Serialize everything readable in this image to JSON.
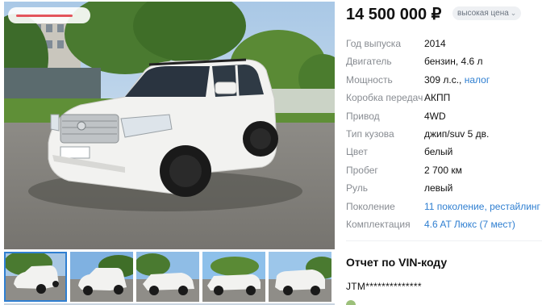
{
  "price": {
    "amount": "14 500 000 ₽",
    "badge_label": "высокая цена"
  },
  "specs": [
    {
      "label": "Год выпуска",
      "value": "2014"
    },
    {
      "label": "Двигатель",
      "value": "бензин, 4.6 л"
    },
    {
      "label": "Мощность",
      "value": "309 л.с.,",
      "link": "налог"
    },
    {
      "label": "Коробка передач",
      "value": "АКПП"
    },
    {
      "label": "Привод",
      "value": "4WD"
    },
    {
      "label": "Тип кузова",
      "value": "джип/suv 5 дв."
    },
    {
      "label": "Цвет",
      "value": "белый"
    },
    {
      "label": "Пробег",
      "value": "2 700 км"
    },
    {
      "label": "Руль",
      "value": "левый"
    },
    {
      "label": "Поколение",
      "link": "11 поколение, рестайлинг"
    },
    {
      "label": "Комплектация",
      "link": "4.6 AT Люкс (7 мест)"
    }
  ],
  "vin": {
    "title": "Отчет по VIN-коду",
    "value": "JTM**************"
  },
  "gallery": {
    "thumbnail_count": 5,
    "active_index": 0
  },
  "colors": {
    "link": "#2f7fd1",
    "label": "#888c92",
    "badge_bg": "#eef0f3",
    "car_body": "#f2f2f0"
  },
  "icons": {
    "badge_chevron": "chevron-down-icon"
  }
}
